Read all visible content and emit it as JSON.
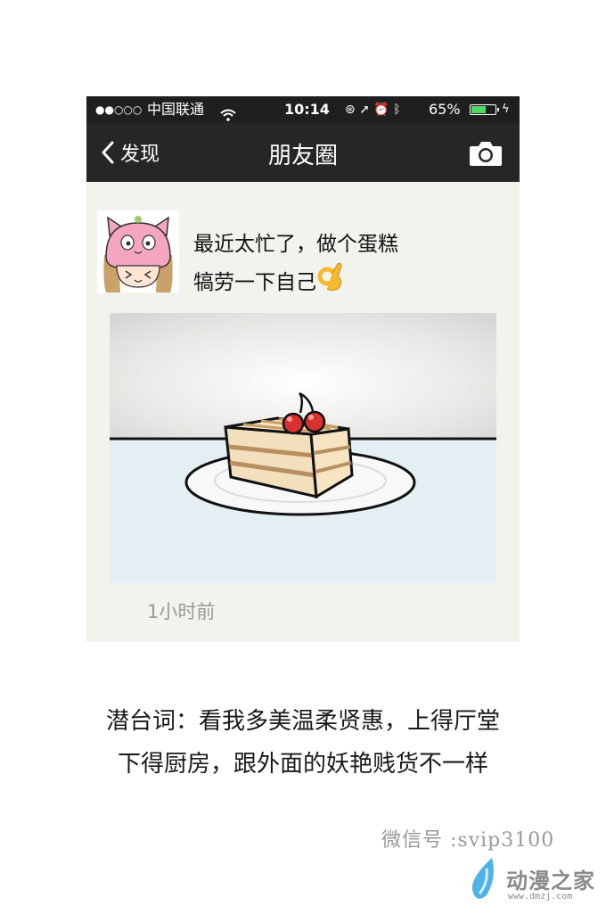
{
  "status_bar": {
    "signal": "●●○○○",
    "carrier": "中国联通",
    "time": "10:14",
    "battery_percent": "65%",
    "battery_level": 0.65
  },
  "nav": {
    "back_label": "发现",
    "title": "朋友圈",
    "camera_icon": "camera-icon"
  },
  "post": {
    "text_line1": "最近太忙了，做个蛋糕",
    "text_line2": "犒劳一下自己",
    "emoji": "ok-hand-icon",
    "time_ago": "1小时前"
  },
  "caption": {
    "line1": "潜台词：看我多美温柔贤惠，上得厅堂",
    "line2": "下得厨房，跟外面的妖艳贱货不一样"
  },
  "watermark": {
    "wechat_id": "微信号 :svip3100",
    "site_name": "动漫之家",
    "site_url": "www.dmzj.com"
  },
  "colors": {
    "statusbar_bg": "#1f1f1f",
    "navbar_bg": "#262626",
    "post_bg": "#f3f3ee",
    "battery_fill": "#4cd964"
  }
}
